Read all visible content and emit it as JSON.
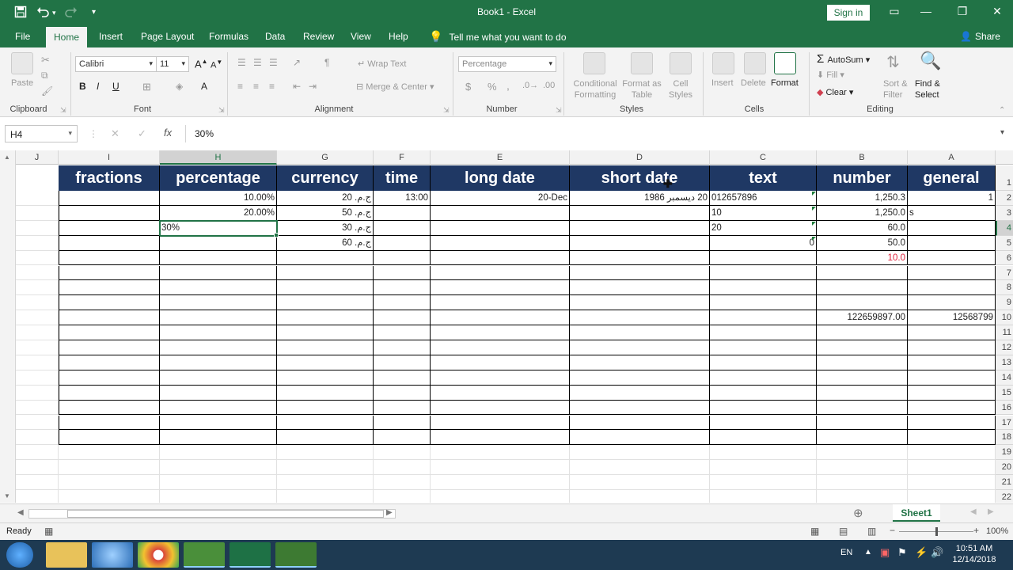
{
  "titlebar": {
    "title": "Book1  -  Excel",
    "sign_in": "Sign in",
    "save_icon": "save-icon",
    "undo_icon": "undo-icon",
    "redo_icon": "redo-icon"
  },
  "ribbon_tabs": [
    "File",
    "Home",
    "Insert",
    "Page Layout",
    "Formulas",
    "Data",
    "Review",
    "View",
    "Help"
  ],
  "active_tab": "Home",
  "tell_me": "Tell me what you want to do",
  "share": "Share",
  "ribbon": {
    "clipboard": {
      "label": "Clipboard",
      "paste": "Paste"
    },
    "font": {
      "label": "Font",
      "name": "Calibri",
      "size": "11",
      "bold": "B",
      "italic": "I",
      "underline": "U"
    },
    "alignment": {
      "label": "Alignment",
      "wrap_text": "Wrap Text",
      "merge_center": "Merge & Center"
    },
    "number": {
      "label": "Number",
      "format": "Percentage",
      "currency_symbol": "$",
      "percent_symbol": "%",
      "comma_symbol": ","
    },
    "styles": {
      "label": "Styles",
      "conditional_formatting": "Conditional\nFormatting",
      "format_as_table": "Format as\nTable",
      "cell_styles": "Cell\nStyles"
    },
    "cells": {
      "label": "Cells",
      "insert": "Insert",
      "delete": "Delete",
      "format": "Format"
    },
    "editing": {
      "label": "Editing",
      "autosum": "AutoSum",
      "fill": "Fill",
      "clear": "Clear",
      "sort_filter": "Sort &\nFilter",
      "find_select": "Find &\nSelect"
    }
  },
  "formula_bar": {
    "name_box": "H4",
    "content": "30%"
  },
  "columns": [
    "J",
    "I",
    "H",
    "G",
    "F",
    "E",
    "D",
    "C",
    "B",
    "A"
  ],
  "rows": [
    "1",
    "2",
    "3",
    "4",
    "5",
    "6",
    "7",
    "8",
    "9",
    "10",
    "11",
    "12",
    "13",
    "14",
    "15",
    "16",
    "17",
    "18",
    "19",
    "20",
    "21",
    "22"
  ],
  "headers": {
    "I": "fractions",
    "H": "percentage",
    "G": "currency",
    "F": "time",
    "E": "long date",
    "D": "short date",
    "C": "text",
    "B": "number",
    "A": "general"
  },
  "cells": {
    "H2": "10.00%",
    "H3": "20.00%",
    "H4": "30%",
    "G2": "ج.م.‏ 20",
    "G3": "ج.م.‏ 50",
    "G4": "ج.م.‏ 30",
    "G5": "ج.م.‏ 60",
    "F2": "13:00",
    "E2": "20-Dec",
    "D2": "20 ديسمبر 1986",
    "C2": "012657896",
    "C3": "10",
    "C4": "20",
    "C5": "0",
    "B2": "1,250.3",
    "B3": "1,250.0",
    "B4": "60.0",
    "B5": "50.0",
    "B6": "10.0",
    "B10": "122659897.00",
    "A2": "1",
    "A3": "s",
    "A10": "12568799"
  },
  "sheet_tab": "Sheet1",
  "status": {
    "ready": "Ready",
    "zoom": "100%"
  },
  "taskbar": {
    "lang": "EN",
    "time": "10:51 AM",
    "date": "12/14/2018"
  },
  "colors": {
    "excel_green": "#217346",
    "header_navy": "#1f3864",
    "negative_red": "#e0203a"
  }
}
